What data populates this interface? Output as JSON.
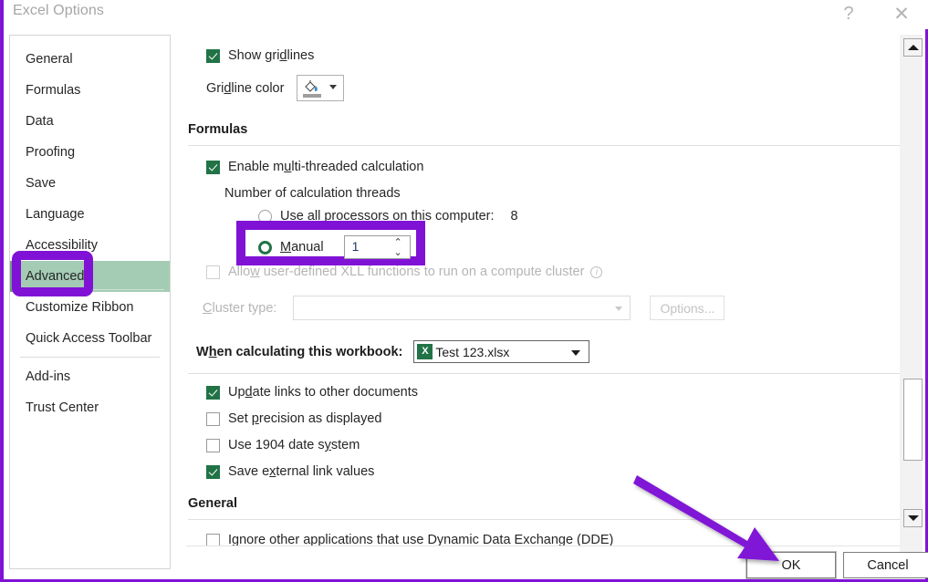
{
  "window": {
    "title": "Excel Options",
    "help_icon": "?",
    "close_icon": "✕"
  },
  "sidebar": {
    "items": [
      {
        "label": "General",
        "selected": false
      },
      {
        "label": "Formulas",
        "selected": false
      },
      {
        "label": "Data",
        "selected": false
      },
      {
        "label": "Proofing",
        "selected": false
      },
      {
        "label": "Save",
        "selected": false
      },
      {
        "label": "Language",
        "selected": false
      },
      {
        "label": "Accessibility",
        "selected": false
      },
      {
        "label": "Advanced",
        "selected": true
      },
      {
        "label": "Customize Ribbon",
        "selected": false
      },
      {
        "label": "Quick Access Toolbar",
        "selected": false
      },
      {
        "label": "Add-ins",
        "selected": false
      },
      {
        "label": "Trust Center",
        "selected": false
      }
    ]
  },
  "pane": {
    "show_gridlines": {
      "label_pre": "Show gri",
      "label_key": "d",
      "label_post": "lines",
      "checked": true
    },
    "gridline_color": {
      "label_pre": "Gri",
      "label_key": "d",
      "label_post": "line color",
      "icon": "paint-bucket-icon"
    },
    "formulas_heading": "Formulas",
    "enable_multithread": {
      "label_pre": "Enable m",
      "label_key": "u",
      "label_post": "lti-threaded calculation",
      "checked": true
    },
    "threads_label": "Number of calculation threads",
    "use_all_processors": {
      "label": "Use all processors on this computer:",
      "value": "8",
      "selected": false
    },
    "manual": {
      "label_pre": "",
      "label_key": "M",
      "label_post": "anual",
      "selected": true,
      "spin_value": "1",
      "spin_up_icon": "⌃",
      "spin_down_icon": "⌄"
    },
    "allow_xll": {
      "label_pre": "Allo",
      "label_key": "w",
      "label_post": " user-defined XLL functions to run on a compute cluster",
      "checked": false,
      "info_icon": "i"
    },
    "cluster_type": {
      "label_pre": "",
      "label_key": "C",
      "label_post": "luster type:",
      "value": "",
      "disabled": true
    },
    "options_button": "Options...",
    "when_calculating": {
      "label_pre": "W",
      "label_key": "h",
      "label_post": "en calculating this workbook:",
      "workbook": "Test 123.xlsx",
      "workbook_icon": "X"
    },
    "workbook_checks": [
      {
        "label_pre": "Up",
        "label_key": "d",
        "label_post": "ate links to other documents",
        "checked": true
      },
      {
        "label_pre": "Set ",
        "label_key": "p",
        "label_post": "recision as displayed",
        "checked": false
      },
      {
        "label_pre": "Use 1904 date s",
        "label_key": "y",
        "label_post": "stem",
        "checked": false
      },
      {
        "label_pre": "Save e",
        "label_key": "x",
        "label_post": "ternal link values",
        "checked": true
      }
    ],
    "general_heading": "General",
    "ignore_dde": {
      "label": "Ignore other applications that use Dynamic Data Exchange (DDE)",
      "checked": false
    }
  },
  "scrollbar": {
    "up_arrow": "up-arrow-icon",
    "down_arrow": "down-arrow-icon"
  },
  "footer": {
    "ok_label": "OK",
    "cancel_label": "Cancel"
  },
  "annotations": {
    "highlight_color": "#8012d6",
    "advanced_box": "advanced-sidebar-highlight",
    "manual_box": "manual-radio-highlight",
    "arrow": "arrow-pointing-to-ok-button"
  }
}
